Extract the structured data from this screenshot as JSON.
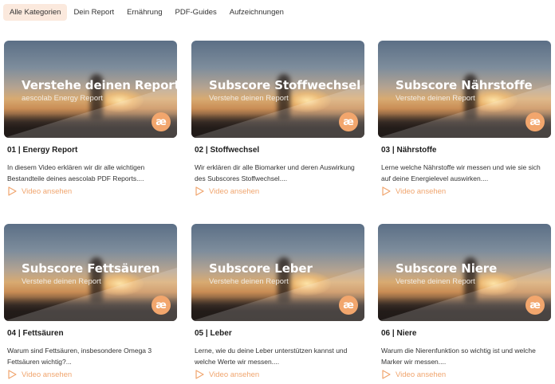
{
  "tabs": [
    {
      "label": "Alle Kategorien",
      "active": true
    },
    {
      "label": "Dein Report",
      "active": false
    },
    {
      "label": "Ernährung",
      "active": false
    },
    {
      "label": "PDF-Guides",
      "active": false
    },
    {
      "label": "Aufzeichnungen",
      "active": false
    }
  ],
  "colors": {
    "accent": "#f0a56e",
    "active_tab_bg": "#fbe9dd",
    "logo_bg": "#f2a66d"
  },
  "logo_glyph": "æ",
  "cta_icon": "play-outline-icon",
  "cards": [
    {
      "thumb_title": "Verstehe deinen Report",
      "thumb_subtitle": "aescolab Energy Report",
      "title": "01 | Energy Report",
      "description": "In diesem Video erklären wir dir alle wichtigen Bestandteile deines aescolab PDF Reports....",
      "cta": "Video ansehen"
    },
    {
      "thumb_title": "Subscore Stoffwechsel",
      "thumb_subtitle": "Verstehe deinen Report",
      "title": "02 | Stoffwechsel",
      "description": "Wir erklären dir alle Biomarker und deren Auswirkung des Subscores Stoffwechsel....",
      "cta": "Video ansehen"
    },
    {
      "thumb_title": "Subscore Nährstoffe",
      "thumb_subtitle": "Verstehe deinen Report",
      "title": "03 | Nährstoffe",
      "description": "Lerne welche Nährstoffe wir messen und wie sie sich auf deine Energielevel auswirken....",
      "cta": "Video ansehen"
    },
    {
      "thumb_title": "Subscore Fettsäuren",
      "thumb_subtitle": "Verstehe deinen Report",
      "title": "04 | Fettsäuren",
      "description": "Warum sind Fettsäuren, insbesondere Omega 3 Fettsäuren wichtig?...",
      "cta": "Video ansehen"
    },
    {
      "thumb_title": "Subscore Leber",
      "thumb_subtitle": "Verstehe deinen Report",
      "title": "05 | Leber",
      "description": "Lerne, wie du deine Leber unterstützen kannst und welche Werte wir messen....",
      "cta": "Video ansehen"
    },
    {
      "thumb_title": "Subscore Niere",
      "thumb_subtitle": "Verstehe deinen Report",
      "title": "06 | Niere",
      "description": "Warum die Nierenfunktion so wichtig ist und welche Marker wir messen....",
      "cta": "Video ansehen"
    }
  ]
}
